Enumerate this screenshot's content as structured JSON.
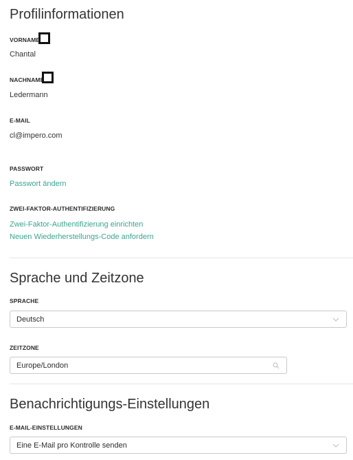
{
  "profile": {
    "title": "Profilinformationen",
    "first_name": {
      "label": "VORNAME",
      "value": "Chantal"
    },
    "last_name": {
      "label": "NACHNAME",
      "value": "Ledermann"
    },
    "email": {
      "label": "E-MAIL",
      "value": "cl@impero.com"
    },
    "password": {
      "label": "PASSWORT",
      "change_link": "Passwort ändern"
    },
    "two_factor": {
      "label": "ZWEI-FAKTOR-AUTHENTIFIZIERUNG",
      "setup_link": "Zwei-Faktor-Authentifizierung einrichten",
      "recovery_link": "Neuen Wiederherstellungs-Code anfordern"
    }
  },
  "language_timezone": {
    "title": "Sprache und Zeitzone",
    "language": {
      "label": "SPRACHE",
      "value": "Deutsch"
    },
    "timezone": {
      "label": "ZEITZONE",
      "value": "Europe/London"
    }
  },
  "notifications": {
    "title": "Benachrichtigungs-Einstellungen",
    "email_settings": {
      "label": "E-MAIL-EINSTELLUNGEN",
      "value": "Eine E-Mail pro Kontrolle senden"
    }
  },
  "colors": {
    "link": "#3aa590",
    "divider": "#e4e4e4",
    "field_border": "#c9c9c9"
  },
  "icons": {
    "edit": "edit-icon",
    "dropdown": "chevron-down-icon",
    "search": "search-icon"
  }
}
